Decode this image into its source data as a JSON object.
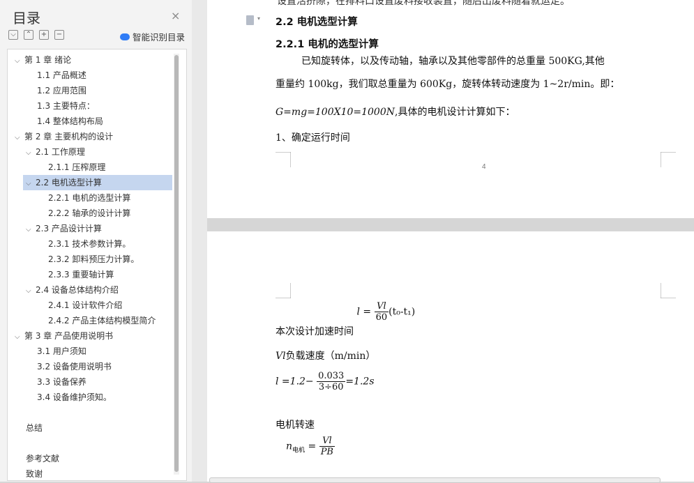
{
  "sidebar": {
    "title": "目录",
    "close_glyph": "×",
    "tools": [
      "⌵",
      "⌃",
      "+",
      "−"
    ],
    "ai_label": "智能识别目录",
    "toc": [
      {
        "label": "第 1 章  绪论",
        "level": 0,
        "expanded": true
      },
      {
        "label": "1.1 产品概述",
        "level": 1
      },
      {
        "label": "1.2  应用范围",
        "level": 1
      },
      {
        "label": "1.3 主要特点：",
        "level": 1
      },
      {
        "label": "1.4  整体结构布局",
        "level": 1
      },
      {
        "label": "第 2 章  主要机构的设计",
        "level": 0,
        "expanded": true
      },
      {
        "label": "2.1 工作原理",
        "level": 1,
        "expanded": true
      },
      {
        "label": "2.1.1 压榨原理",
        "level": 2
      },
      {
        "label": "2.2 电机选型计算",
        "level": 1,
        "expanded": true,
        "selected": true
      },
      {
        "label": "2.2.1 电机的选型计算",
        "level": 2
      },
      {
        "label": "2.2.2 轴承的设计计算",
        "level": 2
      },
      {
        "label": "2.3  产品设计计算",
        "level": 1,
        "expanded": true
      },
      {
        "label": "2.3.1  技术参数计算。",
        "level": 2
      },
      {
        "label": "2.3.2  卸料预压力计算。",
        "level": 2
      },
      {
        "label": "2.3.3  重要轴计算",
        "level": 2
      },
      {
        "label": "2.4 设备总体结构介绍",
        "level": 1,
        "expanded": true
      },
      {
        "label": "2.4.1 设计软件介绍",
        "level": 2
      },
      {
        "label": "2.4.2 产品主体结构模型简介",
        "level": 2
      },
      {
        "label": "第 3 章  产品使用说明书",
        "level": 0,
        "expanded": true
      },
      {
        "label": "3.1  用户须知",
        "level": 1
      },
      {
        "label": "3.2  设备使用说明书",
        "level": 1
      },
      {
        "label": "3.3  设备保养",
        "level": 1
      },
      {
        "label": "3.4 设备维护须知。",
        "level": 1
      },
      {
        "label": "总结",
        "level": 0
      },
      {
        "label": "参考文献",
        "level": 0
      },
      {
        "label": "致谢",
        "level": 0
      }
    ]
  },
  "page1": {
    "top_cut_text": "设置活挤隙，在排料口设置废料接收装置，随后出废料随着就运走。",
    "heading_2_2": "2.2 电机选型计算",
    "heading_2_2_1": "2.2.1 电机的选型计算",
    "para_line1": "已知旋转体，以及传动轴，轴承以及其他零部件的总重量 500KG,其他",
    "para_line2": "重量约 100kg，我们取总重量为 600Kg，旋转体转动速度为 1~2r/min。即：",
    "formula_g": "G=mg=100X10=1000N",
    "formula_g_after": ",具体的电机设计计算如下：",
    "step1": "1、确定运行时间",
    "page_number": "4"
  },
  "page2": {
    "accel_label": "本次设计加速时间",
    "accel_lhs": "l =",
    "accel_num": "Vl",
    "accel_den": "60",
    "accel_tail": "(t₀-t₁)",
    "load_sym": "Vl",
    "load_label": "负载速度（m/min）",
    "calc_lhs": "l =1.2−",
    "calc_num": "0.033",
    "calc_den": "3÷60",
    "calc_rhs": "=1.2s",
    "speed_label": "电机转速",
    "n_lhs": "n",
    "n_sub": "电机",
    "n_eq": "=",
    "n_num": "Vl",
    "n_den": "PB"
  }
}
